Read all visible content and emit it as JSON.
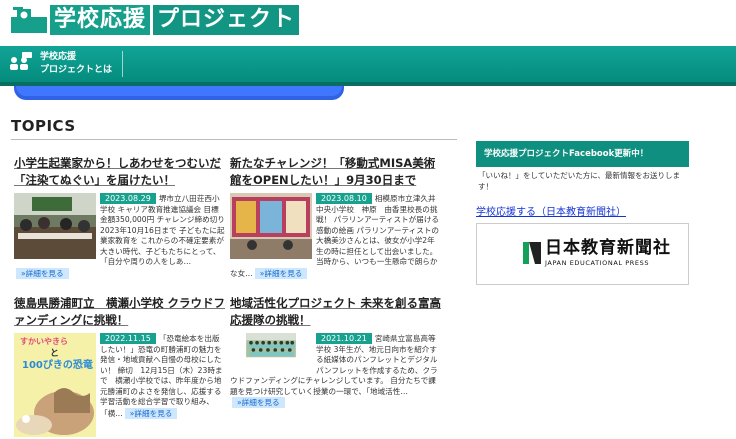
{
  "site": {
    "logo_text_1": "学校応援",
    "logo_text_2": "プロジェクト"
  },
  "nav": {
    "item_line1": "学校応援",
    "item_line2": "プロジェクトとは"
  },
  "section": {
    "title": "TOPICS"
  },
  "cards": [
    {
      "title": "小学生起業家から！しあわせをつむいだ「注染てぬぐい」を届けたい！",
      "date": "2023.08.29",
      "text": "堺市立八田荘西小学校 キャリア教育推進協議会 目標金額350,000円 チャレンジ締め切り　2023年10月16日まで 子どもたに起業家教育を これからの不確定要素が大きい時代、子どもたちにとって、「自分や周りの人をしあ…",
      "more": "»詳細を見る"
    },
    {
      "title": "新たなチャレンジ！「移動式MISA美術館をOPENしたい！」9月30日まで",
      "date": "2023.08.10",
      "text": "相模原市立津久井中央小学校　神原　由香里校長の挑戦！ パラリンアーティストが届ける感動の絵画 パラリンアーティストの大橋美沙さんとは、彼女が小学2年生の時に担任として出会いました。当時から、いつも一生懸命で朗らかな女…",
      "more": "»詳細を見る"
    },
    {
      "title": "徳島県勝浦町立　横瀬小学校 クラウドファンディングに挑戦！",
      "date": "2022.11.15",
      "text": "「恐竜絵本を出版したい！」恐竜の町勝浦町の魅力を発信・地域貢献へ自慢の母校にしたい！ 締切　12月15日（木）23時まで　横瀬小学校では、昨年度から地元勝浦町のよさを発信し、応援する学習活動を総合学習で取り組み、「横…",
      "more": "»詳細を見る"
    },
    {
      "title": "地域活性化プロジェクト 未来を創る富高応援隊の挑戦！",
      "date": "2021.10.21",
      "text": "宮崎県立富島高等学校 3年生が、地元日向市を紹介する紙媒体のパンフレットとデジタルパンフレットを作成するため、クラウドファンディングにチャレンジしています。 自分たちで課題を見つけ研究していく授業の一環で、「地域活性…",
      "more": "»詳細を見る"
    }
  ],
  "book_cover_text": {
    "line1": "すかいやきら",
    "line2": "と",
    "line3": "100ぴきの恐竜"
  },
  "sidebar": {
    "fb_heading": "学校応援プロジェクトFacebook更新中！",
    "fb_text": "「いいね！」をしていただいた方に、最新情報をお送りします！",
    "link": "学校応援する（日本教育新聞社）",
    "press_jp": "日本教育新聞社",
    "press_en": "JAPAN EDUCATIONAL PRESS"
  },
  "colors": {
    "brand": "#16a08c",
    "nav_bg": "#048c7d",
    "link": "#1433d6",
    "more_bg": "#cde7ff"
  }
}
